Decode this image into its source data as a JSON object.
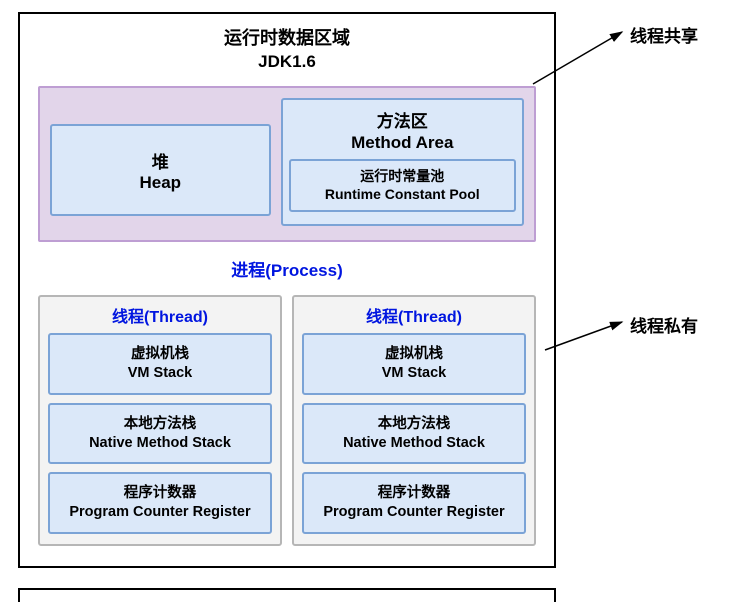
{
  "title": {
    "main": "运行时数据区域",
    "sub": "JDK1.6"
  },
  "shared": {
    "heap": {
      "cn": "堆",
      "en": "Heap"
    },
    "methodArea": {
      "cn": "方法区",
      "en": "Method Area",
      "constantPool": {
        "cn": "运行时常量池",
        "en": "Runtime Constant Pool"
      }
    }
  },
  "processLabel": "进程(Process)",
  "threadLabel": "线程(Thread)",
  "threadItems": {
    "vmStack": {
      "cn": "虚拟机栈",
      "en": "VM Stack"
    },
    "nativeStack": {
      "cn": "本地方法栈",
      "en": "Native Method Stack"
    },
    "pcRegister": {
      "cn": "程序计数器",
      "en": "Program Counter Register"
    }
  },
  "annotations": {
    "shared": "线程共享",
    "private": "线程私有"
  }
}
